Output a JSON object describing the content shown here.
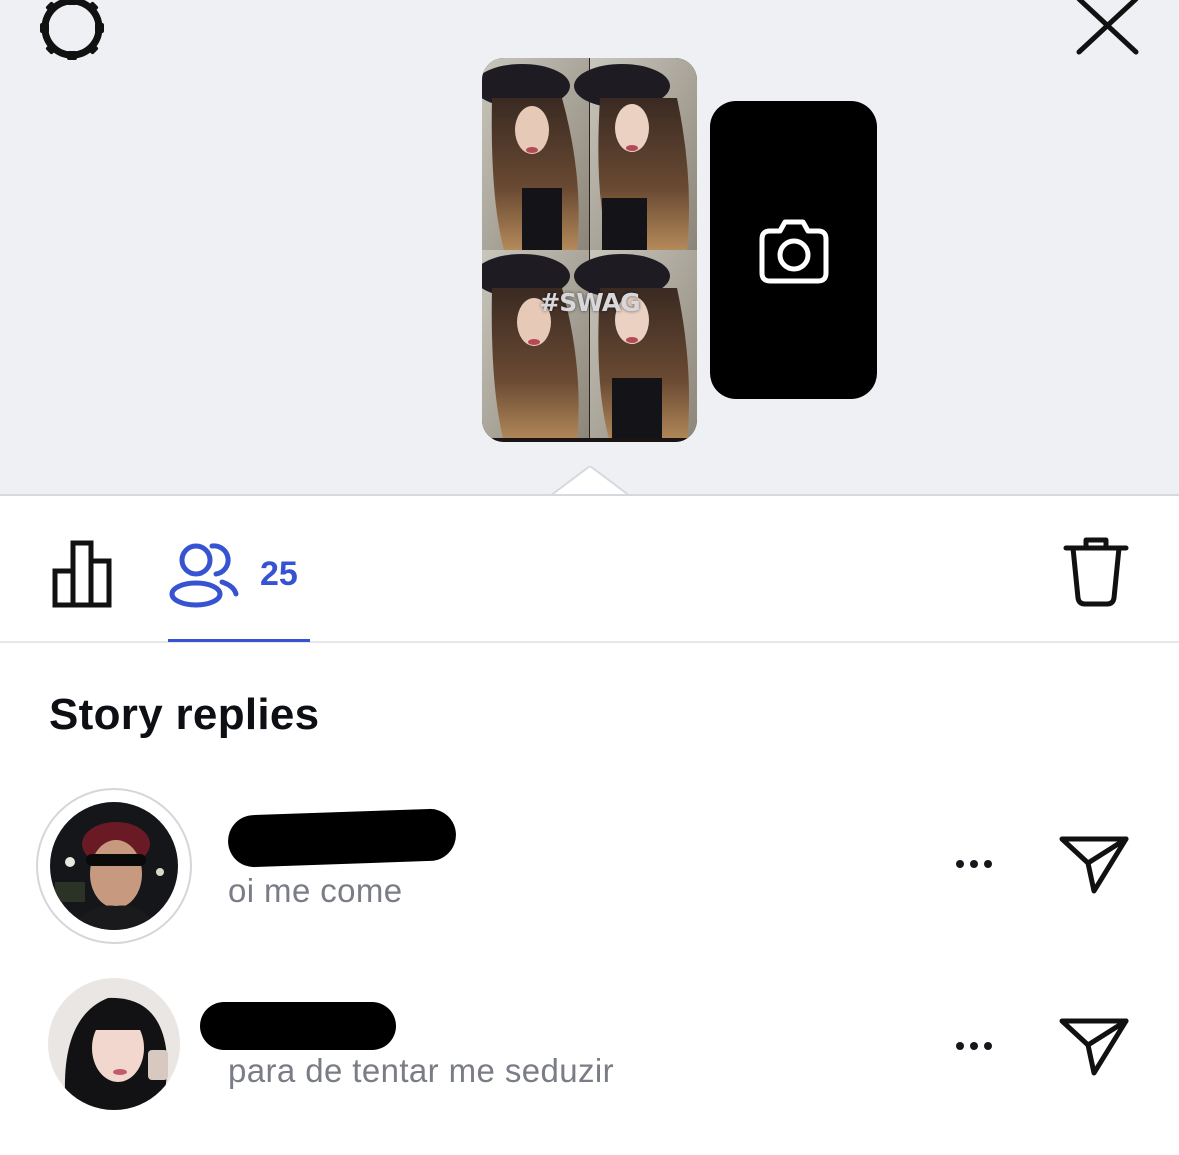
{
  "header": {
    "settings_icon": "gear-icon",
    "close_icon": "close-icon"
  },
  "story": {
    "overlay_text": "#SWAG",
    "viewer_count": "25",
    "viewers_icon": "people-icon",
    "camera_icon": "camera-icon"
  },
  "tabs": {
    "stats_icon": "bar-chart-icon",
    "viewers_icon": "people-icon",
    "viewers_count": "25",
    "delete_icon": "trash-icon",
    "active_color": "#3653d1"
  },
  "replies": {
    "title": "Story replies",
    "items": [
      {
        "name_redacted": true,
        "message": "oi me come",
        "more_icon": "more-icon",
        "send_icon": "send-icon"
      },
      {
        "name_redacted": true,
        "message": "para de tentar me seduzir",
        "more_icon": "more-icon",
        "send_icon": "send-icon"
      }
    ]
  }
}
